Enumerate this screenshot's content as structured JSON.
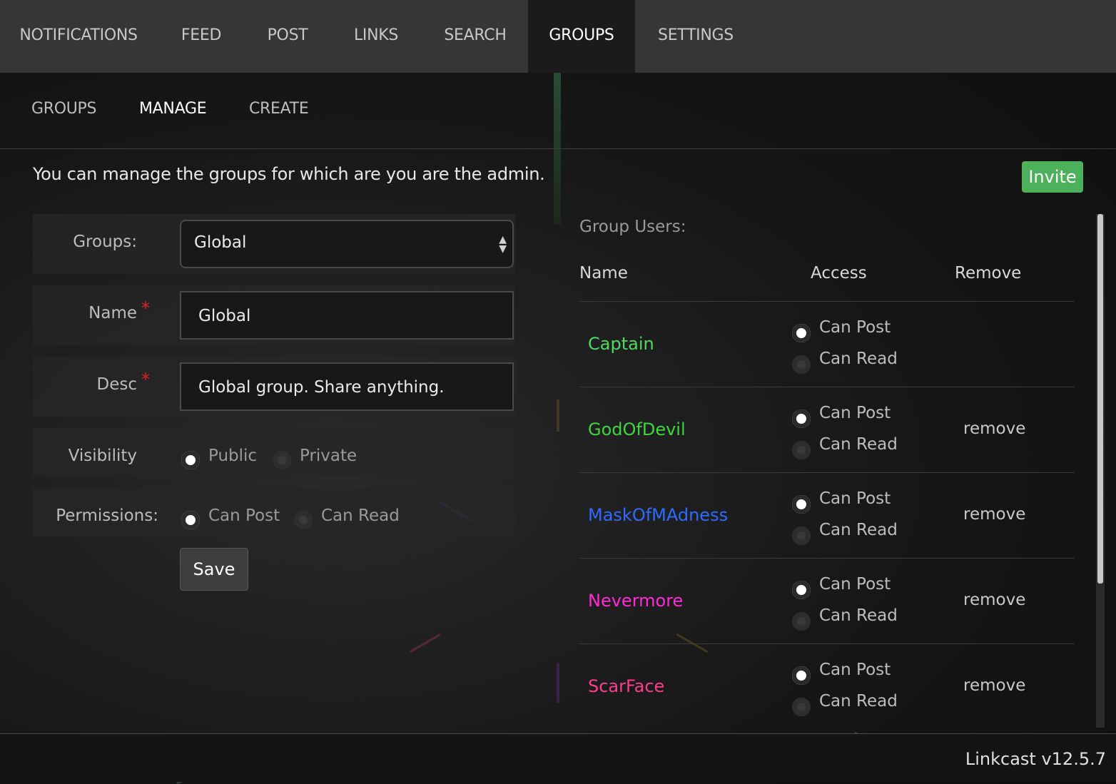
{
  "topnav": {
    "tabs": [
      {
        "label": "NOTIFICATIONS"
      },
      {
        "label": "FEED"
      },
      {
        "label": "POST"
      },
      {
        "label": "LINKS"
      },
      {
        "label": "SEARCH"
      },
      {
        "label": "GROUPS"
      },
      {
        "label": "SETTINGS"
      }
    ],
    "active_index": 5
  },
  "subnav": {
    "tabs": [
      {
        "label": "GROUPS"
      },
      {
        "label": "MANAGE"
      },
      {
        "label": "CREATE"
      }
    ],
    "active_index": 1
  },
  "intro": "You can manage the groups for which are you are the admin.",
  "invite_label": "Invite",
  "form": {
    "groups_label": "Groups:",
    "groups_selected": "Global",
    "name_label": "Name",
    "name_value": "Global",
    "desc_label": "Desc",
    "desc_value": "Global group. Share anything.",
    "required_mark": "*",
    "visibility_label": "Visibility",
    "visibility_options": [
      "Public",
      "Private"
    ],
    "visibility_selected": "Public",
    "permissions_label": "Permissions:",
    "permissions_options": [
      "Can Post",
      "Can Read"
    ],
    "permissions_selected": "Can Post",
    "save_label": "Save"
  },
  "users": {
    "title": "Group Users:",
    "headers": {
      "name": "Name",
      "access": "Access",
      "remove": "Remove"
    },
    "access_options": [
      "Can Post",
      "Can Read"
    ],
    "remove_label": "remove",
    "rows": [
      {
        "name": "Captain",
        "color": "#4cd964",
        "access": "Can Post",
        "removable": false
      },
      {
        "name": "GodOfDevil",
        "color": "#3ed63e",
        "access": "Can Post",
        "removable": true
      },
      {
        "name": "MaskOfMAdness",
        "color": "#2f6bff",
        "access": "Can Post",
        "removable": true
      },
      {
        "name": "Nevermore",
        "color": "#ff2bd6",
        "access": "Can Post",
        "removable": true
      },
      {
        "name": "ScarFace",
        "color": "#ff3d8b",
        "access": "Can Post",
        "removable": true
      }
    ]
  },
  "footer": {
    "version": "Linkcast v12.5.7"
  }
}
